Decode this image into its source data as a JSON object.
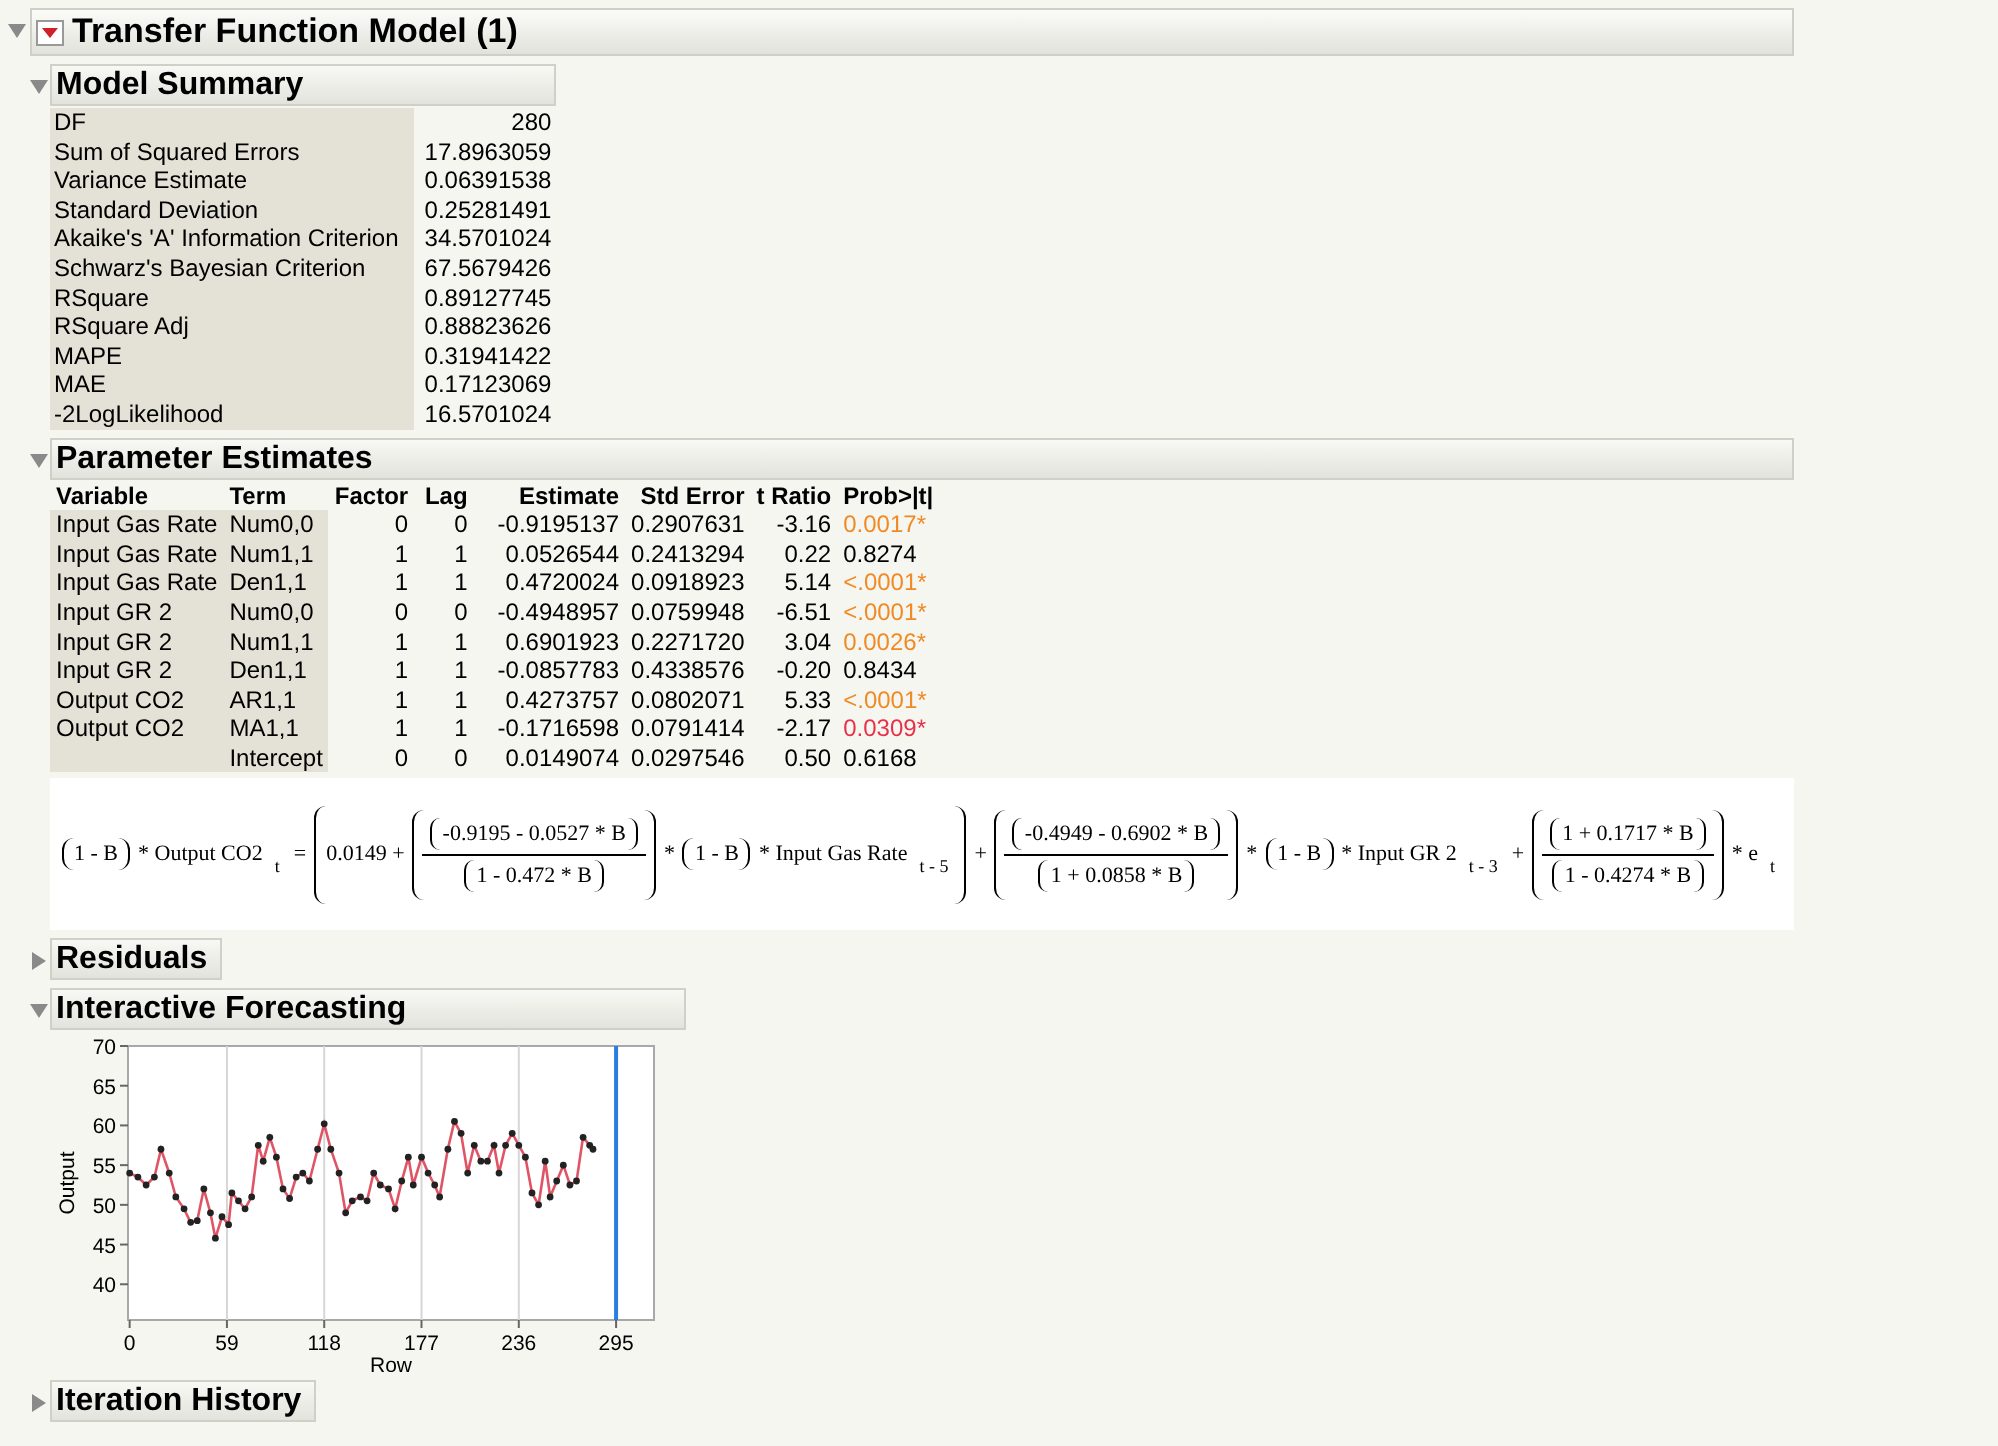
{
  "report": {
    "title": "Transfer Function Model (1)",
    "expanded": true,
    "sections": [
      {
        "kind": "summary",
        "title": "Model Summary",
        "expanded": true,
        "rows": [
          {
            "label": "DF",
            "value": "280"
          },
          {
            "label": "Sum of Squared Errors",
            "value": "17.8963059"
          },
          {
            "label": "Variance Estimate",
            "value": "0.06391538"
          },
          {
            "label": "Standard Deviation",
            "value": "0.25281491"
          },
          {
            "label": "Akaike's 'A' Information Criterion",
            "value": "34.5701024"
          },
          {
            "label": "Schwarz's Bayesian Criterion",
            "value": "67.5679426"
          },
          {
            "label": "RSquare",
            "value": "0.89127745"
          },
          {
            "label": "RSquare Adj",
            "value": "0.88823626"
          },
          {
            "label": "MAPE",
            "value": "0.31941422"
          },
          {
            "label": "MAE",
            "value": "0.17123069"
          },
          {
            "label": "-2LogLikelihood",
            "value": "16.5701024"
          }
        ]
      },
      {
        "kind": "parameters",
        "title": "Parameter Estimates",
        "expanded": true,
        "columns": [
          "Variable",
          "Term",
          "Factor",
          "Lag",
          "Estimate",
          "Std Error",
          "t Ratio",
          "Prob>|t|"
        ],
        "rows": [
          {
            "variable": "Input Gas Rate",
            "term": "Num0,0",
            "factor": "0",
            "lag": "0",
            "estimate": "-0.9195137",
            "std_error": "0.2907631",
            "t_ratio": "-3.16",
            "prob": "0.0017*",
            "color": "#f08a24"
          },
          {
            "variable": "Input Gas Rate",
            "term": "Num1,1",
            "factor": "1",
            "lag": "1",
            "estimate": "0.0526544",
            "std_error": "0.2413294",
            "t_ratio": "0.22",
            "prob": "0.8274",
            "color": "#000000"
          },
          {
            "variable": "Input Gas Rate",
            "term": "Den1,1",
            "factor": "1",
            "lag": "1",
            "estimate": "0.4720024",
            "std_error": "0.0918923",
            "t_ratio": "5.14",
            "prob": "<.0001*",
            "color": "#f08a24"
          },
          {
            "variable": "Input GR 2",
            "term": "Num0,0",
            "factor": "0",
            "lag": "0",
            "estimate": "-0.4948957",
            "std_error": "0.0759948",
            "t_ratio": "-6.51",
            "prob": "<.0001*",
            "color": "#f08a24"
          },
          {
            "variable": "Input GR 2",
            "term": "Num1,1",
            "factor": "1",
            "lag": "1",
            "estimate": "0.6901923",
            "std_error": "0.2271720",
            "t_ratio": "3.04",
            "prob": "0.0026*",
            "color": "#f08a24"
          },
          {
            "variable": "Input GR 2",
            "term": "Den1,1",
            "factor": "1",
            "lag": "1",
            "estimate": "-0.0857783",
            "std_error": "0.4338576",
            "t_ratio": "-0.20",
            "prob": "0.8434",
            "color": "#000000"
          },
          {
            "variable": "Output CO2",
            "term": "AR1,1",
            "factor": "1",
            "lag": "1",
            "estimate": "0.4273757",
            "std_error": "0.0802071",
            "t_ratio": "5.33",
            "prob": "<.0001*",
            "color": "#f08a24"
          },
          {
            "variable": "Output CO2",
            "term": "MA1,1",
            "factor": "1",
            "lag": "1",
            "estimate": "-0.1716598",
            "std_error": "0.0791414",
            "t_ratio": "-2.17",
            "prob": "0.0309*",
            "color": "#e8304a"
          },
          {
            "term": "Intercept",
            "factor": "0",
            "lag": "0",
            "estimate": "0.0149074",
            "std_error": "0.0297546",
            "t_ratio": "0.50",
            "prob": "0.6168",
            "color": "#000000"
          }
        ],
        "equation": [
          {
            "kind": "group",
            "items": [
              {
                "kind": "text",
                "text": "1 - B"
              }
            ]
          },
          {
            "kind": "text",
            "text": "* Output CO2"
          },
          {
            "kind": "sub",
            "text": "t"
          },
          {
            "kind": "text",
            "text": "="
          },
          {
            "kind": "group",
            "items": [
              {
                "kind": "text",
                "text": "0.0149 +"
              },
              {
                "kind": "group",
                "items": [
                  {
                    "kind": "frac",
                    "num": "-0.9195 - 0.0527 * B",
                    "den": "1 - 0.472 * B"
                  }
                ]
              },
              {
                "kind": "text",
                "text": "*"
              },
              {
                "kind": "group",
                "items": [
                  {
                    "kind": "text",
                    "text": "1 - B"
                  }
                ]
              },
              {
                "kind": "text",
                "text": "* Input Gas Rate"
              },
              {
                "kind": "sub",
                "text": "t - 5"
              }
            ]
          },
          {
            "kind": "text",
            "text": "+"
          },
          {
            "kind": "group",
            "items": [
              {
                "kind": "frac",
                "num": "-0.4949 - 0.6902 * B",
                "den": "1 + 0.0858 * B"
              }
            ]
          },
          {
            "kind": "text",
            "text": "*"
          },
          {
            "kind": "group",
            "items": [
              {
                "kind": "text",
                "text": "1 - B"
              }
            ]
          },
          {
            "kind": "text",
            "text": "* Input GR 2"
          },
          {
            "kind": "sub",
            "text": "t - 3"
          },
          {
            "kind": "text",
            "text": "+"
          },
          {
            "kind": "group",
            "items": [
              {
                "kind": "frac",
                "num": "1 + 0.1717 * B",
                "den": "1 - 0.4274 * B"
              }
            ]
          },
          {
            "kind": "text",
            "text": "* e"
          },
          {
            "kind": "sub",
            "text": "t"
          }
        ]
      },
      {
        "title": "Residuals",
        "expanded": false
      },
      {
        "kind": "chart",
        "title": "Interactive Forecasting",
        "expanded": true,
        "chart_data": {
          "type": "line",
          "xlabel": "Row",
          "ylabel": "Output",
          "xlim": [
            -1,
            318
          ],
          "ylim": [
            35.5,
            70
          ],
          "xticks": [
            0,
            59,
            118,
            177,
            236,
            295
          ],
          "yticks": [
            40,
            45,
            50,
            55,
            60,
            65,
            70
          ],
          "x": [
            0,
            5,
            10,
            15,
            19,
            24,
            28,
            33,
            37,
            41,
            45,
            49,
            52,
            56,
            60,
            62,
            66,
            70,
            74,
            78,
            81,
            85,
            89,
            93,
            97,
            101,
            105,
            109,
            114,
            118,
            122,
            127,
            131,
            135,
            140,
            144,
            148,
            152,
            157,
            161,
            165,
            169,
            172,
            177,
            181,
            185,
            188,
            193,
            197,
            201,
            205,
            209,
            213,
            217,
            221,
            224,
            228,
            232,
            236,
            240,
            244,
            248,
            252,
            255,
            259,
            263,
            267,
            271,
            275,
            279,
            281
          ],
          "grid": true,
          "series": [
            {
              "color": "#e05565",
              "marker": "circle",
              "values": [
                54,
                53.5,
                52.5,
                53.5,
                57,
                54,
                51,
                49.5,
                47.8,
                48,
                52,
                49,
                45.8,
                48.5,
                47.5,
                51.5,
                50.5,
                49.5,
                51,
                57.5,
                55.5,
                58.5,
                56,
                52,
                50.8,
                53.5,
                54,
                53,
                57,
                60.2,
                57,
                54,
                49,
                50.5,
                51,
                50.5,
                54,
                52.5,
                52,
                49.5,
                53,
                56,
                52.5,
                56,
                54,
                52.5,
                51,
                57,
                60.5,
                59,
                54,
                57.5,
                55.5,
                55.5,
                57.5,
                54,
                57.5,
                59,
                57.5,
                56,
                51.5,
                50,
                55.5,
                51,
                53,
                55,
                52.5,
                53,
                58.5,
                57.5,
                57
              ]
            }
          ],
          "ref_lines": [
            {
              "axis": "x",
              "value": 295,
              "color": "#2a7de1"
            }
          ]
        }
      },
      {
        "title": "Iteration History",
        "expanded": false
      }
    ]
  }
}
